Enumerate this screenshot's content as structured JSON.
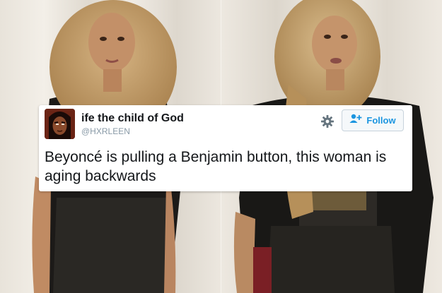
{
  "tweet": {
    "display_name": "ife the child of God",
    "handle": "@HXRLEEN",
    "follow_label": "Follow",
    "text": "Beyoncé is pulling a Benjamin button, this woman is aging backwards"
  },
  "colors": {
    "follow_accent": "#1b95e0",
    "handle_gray": "#8899a6"
  },
  "icons": [
    "gear-icon",
    "add-user-icon"
  ]
}
